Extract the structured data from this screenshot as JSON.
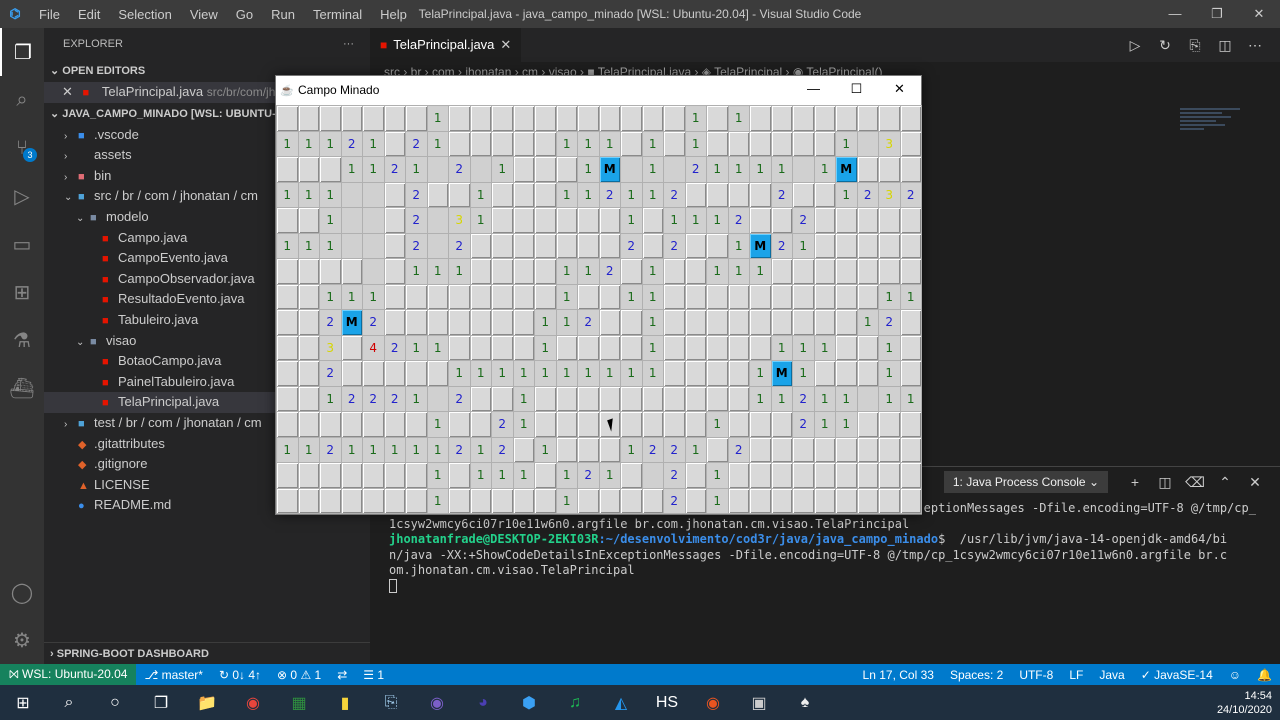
{
  "window": {
    "title": "TelaPrincipal.java - java_campo_minado [WSL: Ubuntu-20.04] - Visual Studio Code",
    "menu": [
      "File",
      "Edit",
      "Selection",
      "View",
      "Go",
      "Run",
      "Terminal",
      "Help"
    ],
    "controls": [
      "—",
      "❐",
      "✕"
    ]
  },
  "activity_bar": {
    "items": [
      "explorer-icon",
      "search-icon",
      "source-control-icon",
      "run-debug-icon",
      "remote-explorer-icon",
      "extensions-icon",
      "testing-icon",
      "docker-icon"
    ],
    "scm_badge": "3",
    "bottom": [
      "account-icon",
      "settings-gear-icon"
    ]
  },
  "sidebar": {
    "title": "EXPLORER",
    "more": "···",
    "open_editors_label": "OPEN EDITORS",
    "open_editor": {
      "name": "TelaPrincipal.java",
      "path": "src/br/com/jhona"
    },
    "project_label": "JAVA_CAMPO_MINADO [WSL: UBUNTU-20.04]",
    "tree": [
      {
        "label": ".vscode",
        "indent": 1,
        "chev": "›",
        "icon": "■",
        "iconColor": "#3b8eea"
      },
      {
        "label": "assets",
        "indent": 1,
        "chev": "›",
        "icon": "",
        "iconColor": ""
      },
      {
        "label": "bin",
        "indent": 1,
        "chev": "›",
        "icon": "■",
        "iconColor": "#e06c75"
      },
      {
        "label": "src / br / com / jhonatan / cm",
        "indent": 1,
        "chev": "⌄",
        "icon": "■",
        "iconColor": "#4fa3d8"
      },
      {
        "label": "modelo",
        "indent": 2,
        "chev": "⌄",
        "icon": "■",
        "iconColor": "#7a8ba3"
      },
      {
        "label": "Campo.java",
        "indent": 3,
        "chev": "",
        "icon": "■",
        "iconColor": "#e51400"
      },
      {
        "label": "CampoEvento.java",
        "indent": 3,
        "chev": "",
        "icon": "■",
        "iconColor": "#e51400"
      },
      {
        "label": "CampoObservador.java",
        "indent": 3,
        "chev": "",
        "icon": "■",
        "iconColor": "#e51400"
      },
      {
        "label": "ResultadoEvento.java",
        "indent": 3,
        "chev": "",
        "icon": "■",
        "iconColor": "#e51400"
      },
      {
        "label": "Tabuleiro.java",
        "indent": 3,
        "chev": "",
        "icon": "■",
        "iconColor": "#e51400"
      },
      {
        "label": "visao",
        "indent": 2,
        "chev": "⌄",
        "icon": "■",
        "iconColor": "#7a8ba3"
      },
      {
        "label": "BotaoCampo.java",
        "indent": 3,
        "chev": "",
        "icon": "■",
        "iconColor": "#e51400"
      },
      {
        "label": "PainelTabuleiro.java",
        "indent": 3,
        "chev": "",
        "icon": "■",
        "iconColor": "#e51400"
      },
      {
        "label": "TelaPrincipal.java",
        "indent": 3,
        "chev": "",
        "icon": "■",
        "iconColor": "#e51400",
        "selected": true
      },
      {
        "label": "test / br / com / jhonatan / cm",
        "indent": 1,
        "chev": "›",
        "icon": "■",
        "iconColor": "#4fa3d8"
      },
      {
        "label": ".gitattributes",
        "indent": 1,
        "chev": "",
        "icon": "◆",
        "iconColor": "#e0622a"
      },
      {
        "label": ".gitignore",
        "indent": 1,
        "chev": "",
        "icon": "◆",
        "iconColor": "#e0622a"
      },
      {
        "label": "LICENSE",
        "indent": 1,
        "chev": "",
        "icon": "▲",
        "iconColor": "#e0622a"
      },
      {
        "label": "README.md",
        "indent": 1,
        "chev": "",
        "icon": "●",
        "iconColor": "#3b8eea"
      }
    ],
    "bottom_section": "SPRING-BOOT DASHBOARD"
  },
  "editor": {
    "tab": "TelaPrincipal.java",
    "breadcrumb": "src › br › com › jhonatan › cm › visao › ■ TelaPrincipal.java › ◈ TelaPrincipal › ◉ TelaPrincipal()",
    "actions": [
      "▷",
      "↻",
      "⎘",
      "◫",
      "⋯"
    ]
  },
  "panel": {
    "console_select": "1: Java Process Console",
    "actions": [
      "+",
      "◫",
      "🗑",
      "⌃",
      "✕"
    ],
    "lines": [
      {
        "text": "                                                                          eptionMessages -Dfile.encoding=UTF-8 @/tmp/cp_"
      },
      {
        "text": "1csyw2wmcy6ci07r10e11w6n0.argfile br.com.jhonatan.cm.visao.TelaPrincipal"
      },
      {
        "user": "jhonatanfrade@DESKTOP-2EKI03R",
        "path": ":~/desenvolvimento/cod3r/java/java_campo_minado",
        "text": "$  /usr/lib/jvm/java-14-openjdk-amd64/bi"
      },
      {
        "text": "n/java -XX:+ShowCodeDetailsInExceptionMessages -Dfile.encoding=UTF-8 @/tmp/cp_1csyw2wmcy6ci07r10e11w6n0.argfile br.c"
      },
      {
        "text": "om.jhonatan.cm.visao.TelaPrincipal"
      }
    ]
  },
  "statusbar": {
    "remote": "⨝ WSL: Ubuntu-20.04",
    "branch": "⎇ master*",
    "sync": "↻ 0↓ 4↑",
    "problems": "⊗ 0 ⚠ 1",
    "live": "⇄",
    "tasks": "☰ 1",
    "position": "Ln 17, Col 33",
    "spaces": "Spaces: 2",
    "encoding": "UTF-8",
    "eol": "LF",
    "language": "Java",
    "java_version": "✓ JavaSE-14",
    "feedback": "☺",
    "notifications": "🔔"
  },
  "taskbar": {
    "items": [
      "⊞",
      "⌕",
      "○",
      "❐",
      "📁",
      "◉",
      "▦",
      "▮",
      "⎘",
      "◉",
      "◕",
      "⬢",
      "♫",
      "◭",
      "HS",
      "◉",
      "▣",
      "♠"
    ],
    "time": "14:54",
    "date": "24/10/2020"
  },
  "minesweeper": {
    "title": "Campo Minado",
    "controls": [
      "—",
      "☐",
      "✕"
    ],
    "rows": [
      "HHHHHHH1HHHHHHHHHHH1H1HHHHHHHH",
      "11121H21HHHHH111H1H1HHHHHH1 3H",
      "HHH1121 2 1HHH1M 1 21111 1MHHH",
      "111  H2HH1HHH112112HHHH2HH1232",
      "HH1  H2 31HHHHHH1H1112HH2HHHHH",
      "111  H2 2HHHHHHH2H2HH1M21HHHHH",
      "HHHH H111HHHH112H1HH111HHHHHHH",
      "HH111HHHHHHHH1HH11HHHHHHHHHH11",
      "HH2M2HHHHHHH112HH1HHHHHHHHH12H",
      "HH3H4211HHHH1HHHH1HHHHH111HH1H",
      "HH2HHHHH1111111111HHHH1M1HHH1H",
      "HH12221 2HH1HHHHHHHHHH11211 11",
      "HHHHHHH1HH21HHHHHHHH1HHH211HHH",
      "11211111212H1HHH1221H2HHHHHHHH",
      "HHHHHHH1H111H121H 2H1HHHHHHHHH",
      "HHHHHHH1HHHHH1HHHH2H1HHHHHHHHH"
    ]
  }
}
